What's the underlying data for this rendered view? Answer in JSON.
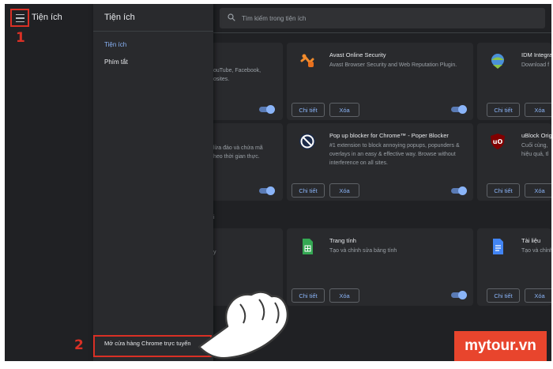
{
  "topbar": {
    "title": "Tiện ích"
  },
  "annotations": {
    "step1": "1",
    "step2": "2"
  },
  "drawer": {
    "title": "Tiện ích",
    "items": [
      {
        "label": "Tiện ích"
      },
      {
        "label": "Phím tắt"
      }
    ],
    "store_link": "Mở cửa hàng Chrome trực tuyến"
  },
  "search": {
    "placeholder": "Tìm kiếm trong tiện ích"
  },
  "section_fragment": "i",
  "buttons": {
    "details": "Chi tiết",
    "remove": "Xóa"
  },
  "cards": [
    {
      "name": "",
      "desc_lines": [
        "ouTube, Facebook,",
        "osites."
      ]
    },
    {
      "name": "Avast Online Security",
      "desc": "Avast Browser Security and Web Reputation Plugin.",
      "icon": "avast-icon"
    },
    {
      "name": "IDM Integra",
      "desc": "Download f",
      "icon": "idm-icon"
    },
    {
      "name": "",
      "desc_lines": [
        "lừa đảo và chứa mã",
        "heo thời gian thực."
      ]
    },
    {
      "name": "Pop up blocker for Chrome™ - Poper Blocker",
      "desc": "#1 extension to block annoying popups, popunders & overlays in an easy & effective way. Browse without interference on all sites.",
      "icon": "poper-blocker-icon"
    },
    {
      "name": "uBlock Orig",
      "desc_lines": [
        "Cuối cùng,",
        "hiệu quả, tl"
      ],
      "icon": "ublock-icon"
    },
    {
      "name": "",
      "desc_lines": [
        "y"
      ]
    },
    {
      "name": "Trang tính",
      "desc": "Tạo và chỉnh sửa bảng tính",
      "icon": "sheets-icon"
    },
    {
      "name": "Tài liệu",
      "desc": "Tạo và chỉnh",
      "icon": "docs-icon"
    }
  ],
  "watermark": "mytour.vn",
  "colors": {
    "accent": "#8ab4f8",
    "highlight": "#d93025",
    "background": "#202124",
    "card": "#292a2d",
    "watermark": "#e8452d"
  }
}
